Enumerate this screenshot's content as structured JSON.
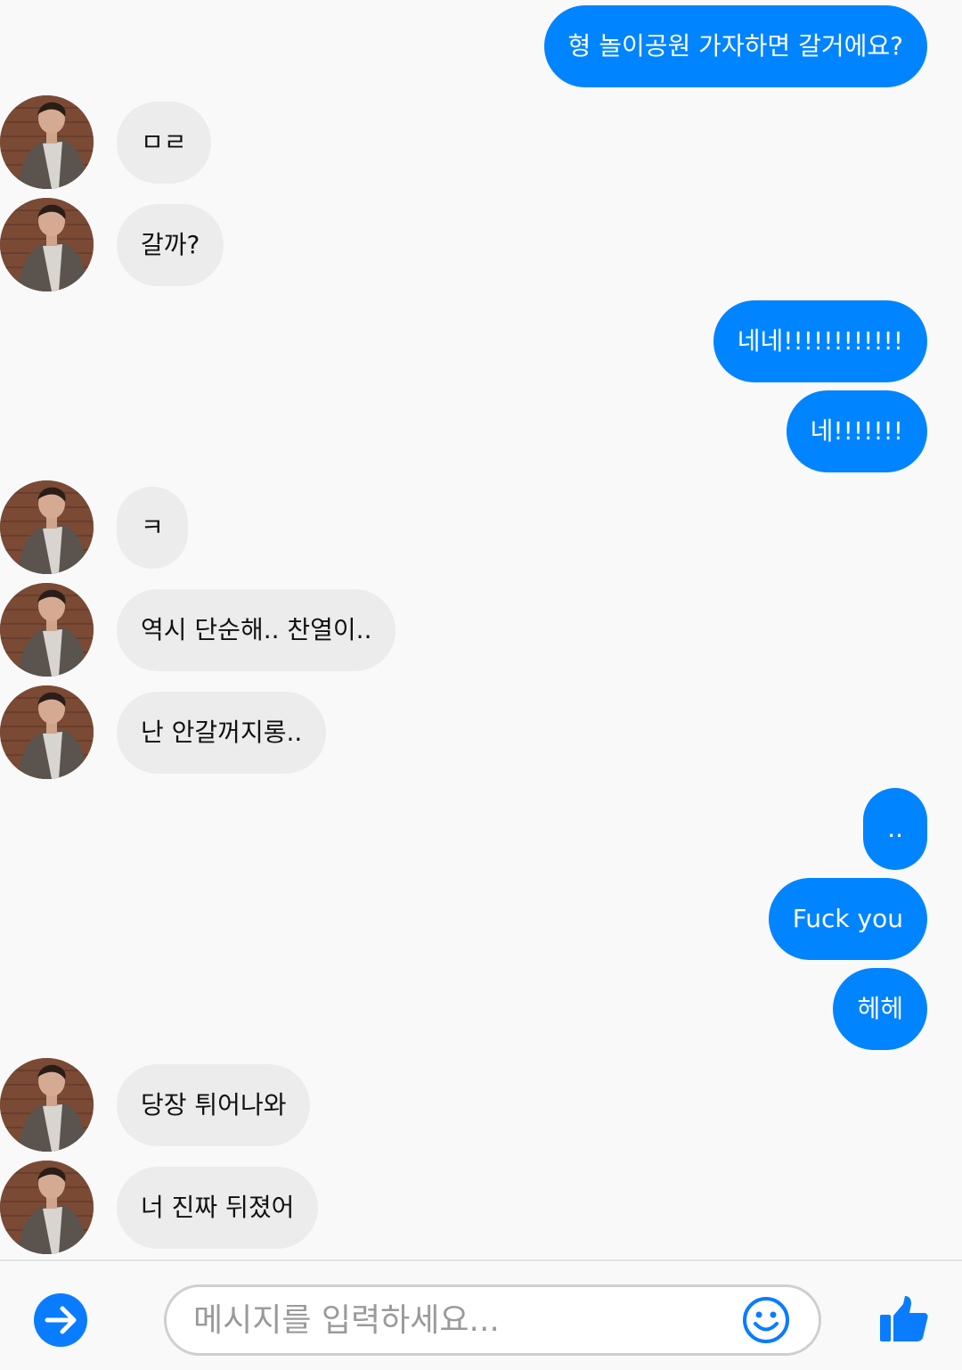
{
  "messages": [
    {
      "side": "out",
      "text": "형 놀이공원 가자하면 갈거에요?"
    },
    {
      "side": "in",
      "text": "ㅁㄹ"
    },
    {
      "side": "in",
      "text": "갈까?"
    },
    {
      "side": "out",
      "text": "네네!!!!!!!!!!!!"
    },
    {
      "side": "out",
      "text": "네!!!!!!!"
    },
    {
      "side": "in",
      "text": "ㅋ"
    },
    {
      "side": "in",
      "text": "역시 단순해.. 찬열이.."
    },
    {
      "side": "in",
      "text": "난 안갈꺼지롱.."
    },
    {
      "side": "out",
      "text": ".."
    },
    {
      "side": "out",
      "text": "Fuck you"
    },
    {
      "side": "out",
      "text": "헤헤"
    },
    {
      "side": "in",
      "text": "당장 튀어나와"
    },
    {
      "side": "in",
      "text": "너 진짜 뒤졌어"
    }
  ],
  "composer": {
    "placeholder": "메시지를 입력하세요...",
    "send_icon": "arrow-right-icon",
    "emoji_icon": "smiley-icon",
    "like_icon": "thumbs-up-icon"
  },
  "colors": {
    "outgoing_bubble": "#0084ff",
    "incoming_bubble": "#ececec",
    "accent": "#0a7cff"
  }
}
